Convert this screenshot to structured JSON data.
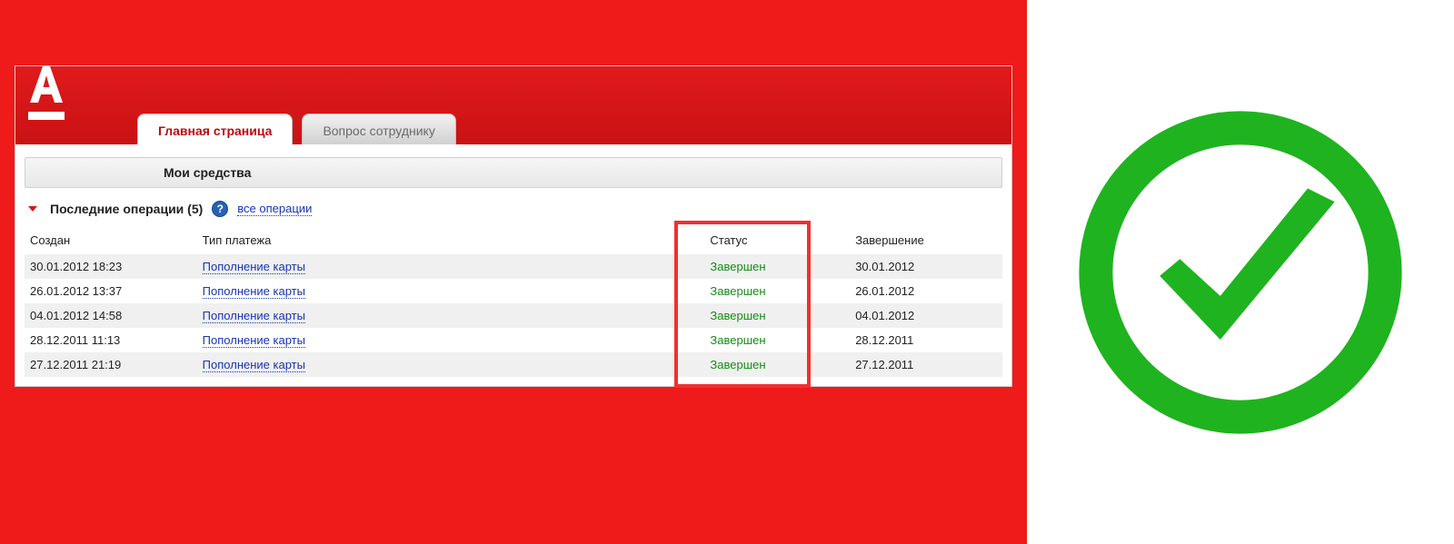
{
  "tabs": {
    "main": "Главная страница",
    "question": "Вопрос сотруднику"
  },
  "section": {
    "myfunds": "Мои средства"
  },
  "ops": {
    "title": "Последние операции (5)",
    "all_link": "все операции"
  },
  "columns": {
    "created": "Создан",
    "type": "Тип платежа",
    "status": "Статус",
    "completion": "Завершение"
  },
  "rows": [
    {
      "created": "30.01.2012 18:23",
      "type": "Пополнение карты",
      "status": "Завершен",
      "completion": "30.01.2012"
    },
    {
      "created": "26.01.2012 13:37",
      "type": "Пополнение карты",
      "status": "Завершен",
      "completion": "26.01.2012"
    },
    {
      "created": "04.01.2012 14:58",
      "type": "Пополнение карты",
      "status": "Завершен",
      "completion": "04.01.2012"
    },
    {
      "created": "28.12.2011 11:13",
      "type": "Пополнение карты",
      "status": "Завершен",
      "completion": "28.12.2011"
    },
    {
      "created": "27.12.2011 21:19",
      "type": "Пополнение карты",
      "status": "Завершен",
      "completion": "27.12.2011"
    }
  ]
}
